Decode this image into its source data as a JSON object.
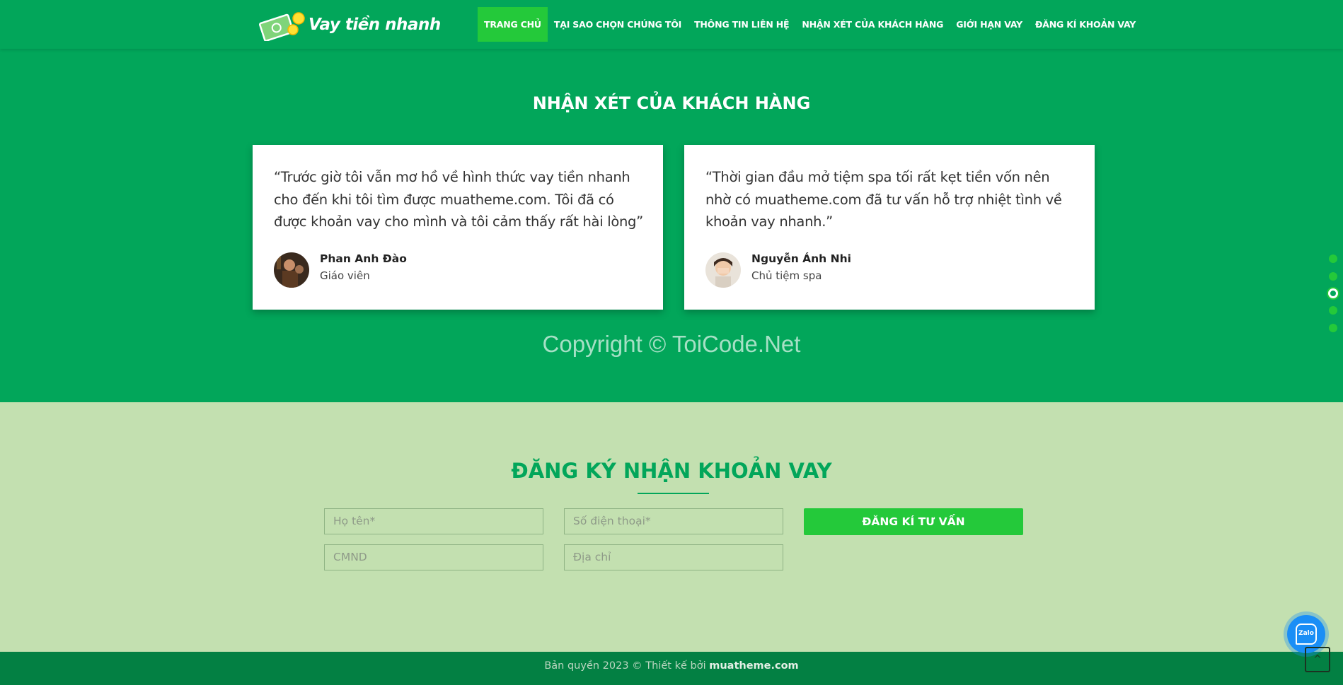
{
  "brand": {
    "name": "Vay tiền nhanh"
  },
  "nav": {
    "items": [
      {
        "label": "TRANG CHỦ",
        "active": true
      },
      {
        "label": "TẠI SAO CHỌN CHÚNG TÔI"
      },
      {
        "label": "THÔNG TIN LIÊN HỆ"
      },
      {
        "label": "NHẬN XÉT CỦA KHÁCH HÀNG"
      },
      {
        "label": "GIỚI HẠN VAY"
      },
      {
        "label": "ĐĂNG KÍ KHOẢN VAY"
      }
    ]
  },
  "testimonials": {
    "title": "NHẬN XÉT CỦA KHÁCH HÀNG",
    "items": [
      {
        "quote": "“Trước giờ tôi vẫn mơ hồ về hình thức vay tiền nhanh cho đến khi tôi tìm được muatheme.com. Tôi đã có được khoản vay cho mình và tôi cảm thấy rất hài lòng”",
        "name": "Phan Anh Đào",
        "role": "Giáo viên"
      },
      {
        "quote": "“Thời gian đầu mở tiệm spa tối rất kẹt tiền vốn nên nhờ có muatheme.com đã tư vấn hỗ trợ nhiệt tình về khoản vay nhanh.”",
        "name": "Nguyễn Ánh Nhi",
        "role": "Chủ tiệm spa"
      }
    ],
    "watermark": "Copyright © ToiCode.Net"
  },
  "registration": {
    "title": "ĐĂNG KÝ NHẬN KHOẢN VAY",
    "name_placeholder": "Họ tên*",
    "phone_placeholder": "Số điện thoại*",
    "id_placeholder": "CMND",
    "address_placeholder": "Địa chỉ",
    "submit_label": "ĐĂNG KÍ TƯ VẤN"
  },
  "footer": {
    "text": "Bản quyền 2023 © Thiết kế bởi",
    "brand": "muatheme.com"
  },
  "widgets": {
    "zalo_label": "Zalo",
    "totop_symbol": "^"
  },
  "colors": {
    "primary": "#02a65a",
    "accent": "#24c93a",
    "form_bg": "#c3e0b0",
    "footer_bg": "#038043"
  }
}
